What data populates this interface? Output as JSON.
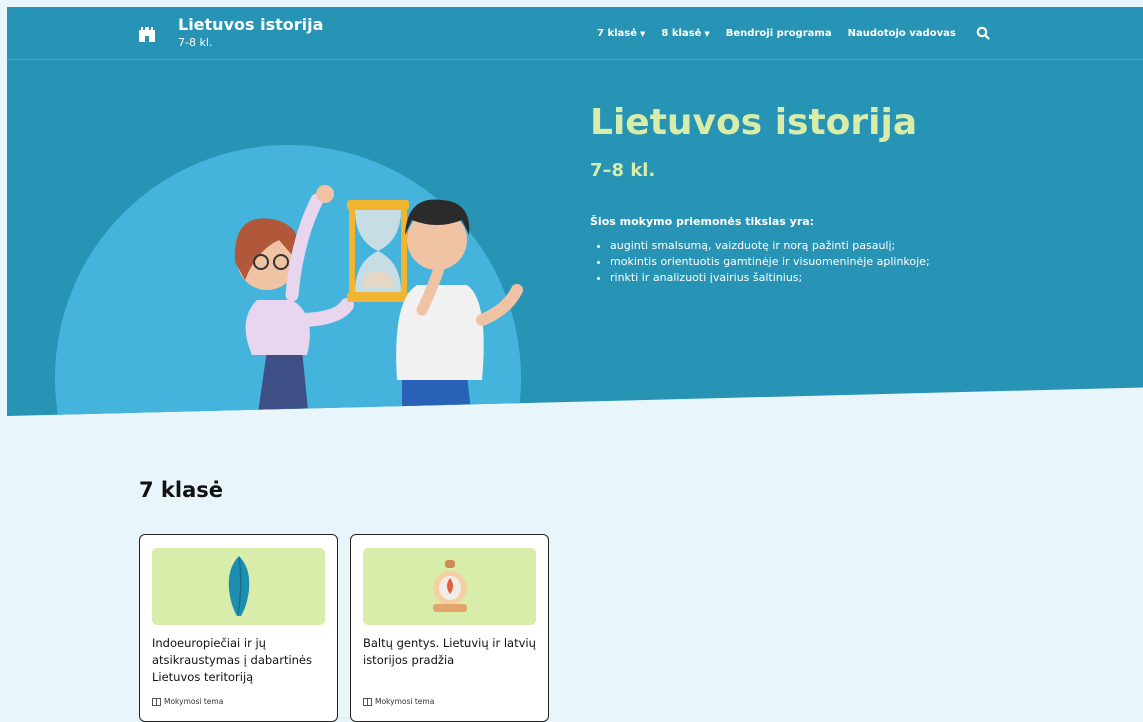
{
  "header": {
    "title": "Lietuvos istorija",
    "subtitle": "7-8 kl.",
    "nav": [
      {
        "label": "7 klasė",
        "dropdown": true
      },
      {
        "label": "8 klasė",
        "dropdown": true
      },
      {
        "label": "Bendroji programa",
        "dropdown": false
      },
      {
        "label": "Naudotojo vadovas",
        "dropdown": false
      }
    ],
    "search_icon": "search-icon"
  },
  "hero": {
    "title": "Lietuvos istorija",
    "grade": "7–8 kl.",
    "lead": "Šios mokymo priemonės tikslas yra:",
    "goals": [
      "auginti smalsumą, vaizduotę ir norą pažinti pasaulį;",
      "mokintis orientuotis gamtinėje ir visuomeninėje aplinkoje;",
      "rinkti ir analizuoti įvairius šaltinius;"
    ]
  },
  "section": {
    "title": "7 klasė",
    "cards": [
      {
        "title": "Indoeuropiečiai ir jų atsikraustymas į dabartinės Lietuvos teritoriją",
        "meta": "Mokymosi tema"
      },
      {
        "title": "Baltų gentys. Lietuvių ir latvių istorijos pradžia",
        "meta": "Mokymosi tema"
      }
    ]
  },
  "colors": {
    "primary": "#2894b5",
    "accent": "#d8edaa",
    "page_bg": "#e8f6fb"
  }
}
